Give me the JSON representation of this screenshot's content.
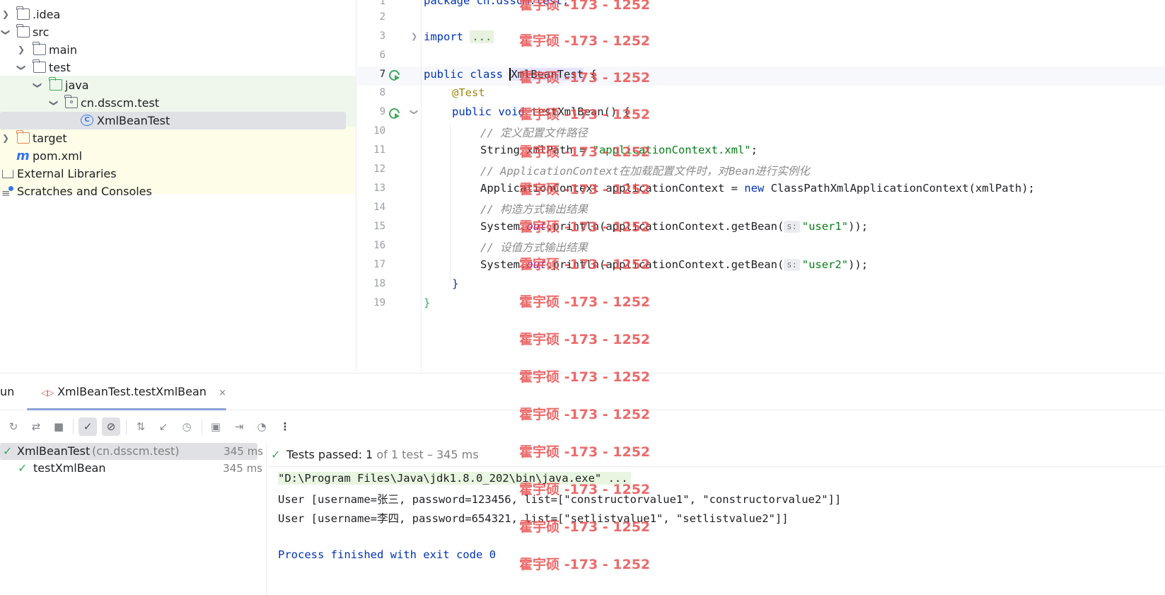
{
  "project_tree": {
    "rows": [
      {
        "label": ".idea"
      },
      {
        "label": "src"
      },
      {
        "label": "main"
      },
      {
        "label": "test"
      },
      {
        "label": "java"
      },
      {
        "label": "cn.dsscm.test"
      },
      {
        "label": "XmlBeanTest"
      },
      {
        "label": "target"
      },
      {
        "label": "pom.xml"
      },
      {
        "label": "External Libraries"
      },
      {
        "label": "Scratches and Consoles"
      }
    ]
  },
  "editor": {
    "line_numbers": [
      "1",
      "2",
      "3",
      "6",
      "7",
      "8",
      "9",
      "10",
      "11",
      "12",
      "13",
      "14",
      "15",
      "16",
      "17",
      "18",
      "19"
    ],
    "lines": {
      "l1": "package cn.dsscm.test;",
      "l3_kw": "import",
      "l3_fold": "...",
      "l7_kw": "public class",
      "l7_name": "XmlBeanTest",
      "l7_brace": " {",
      "l8": "@Test",
      "l9_kw": "public void",
      "l9_name": " testXmlBean",
      "l9_rest": "() {",
      "l10": "// 定义配置文件路径",
      "l11_a": "String xmlPath = ",
      "l11_str": "\"applicationContext.xml\"",
      "l11_b": ";",
      "l12": "// ApplicationContext在加载配置文件时，对Bean进行实例化",
      "l13_a": "ApplicationContext applicationContext = ",
      "l13_kw": "new",
      "l13_b": " ClassPathXmlApplicationContext(xmlPath);",
      "l14": "// 构造方式输出结果",
      "l15_a": "System.",
      "l15_out": "out",
      "l15_b": ".println(applicationContext.getBean(",
      "l15_hint": "s:",
      "l15_str": "\"user1\"",
      "l15_c": "));",
      "l16": "// 设值方式输出结果",
      "l17_a": "System.",
      "l17_out": "out",
      "l17_b": ".println(applicationContext.getBean(",
      "l17_hint": "s:",
      "l17_str": "\"user2\"",
      "l17_c": "));",
      "l18": "}",
      "l19": "}"
    }
  },
  "run_window": {
    "tool_label": "un",
    "tab_label": "XmlBeanTest.testXmlBean",
    "tab_close": "×",
    "test_tree": [
      {
        "name": "XmlBeanTest",
        "pkg": "(cn.dsscm.test)",
        "time": "345 ms"
      },
      {
        "name": "testXmlBean",
        "time": "345 ms"
      }
    ],
    "status_prefix": "Tests passed: ",
    "status_count": "1",
    "status_suffix": " of 1 test – 345 ms",
    "console": [
      "\"D:\\Program Files\\Java\\jdk1.8.0_202\\bin\\java.exe\" ...",
      "User [username=张三, password=123456, list=[\"constructorvalue1\", \"constructorvalue2\"]]",
      "User [username=李四, password=654321, list=[\"setlistvalue1\", \"setlistvalue2\"]]",
      "Process finished with exit code 0"
    ]
  },
  "watermark": "霍宇硕 -173 - 1252"
}
